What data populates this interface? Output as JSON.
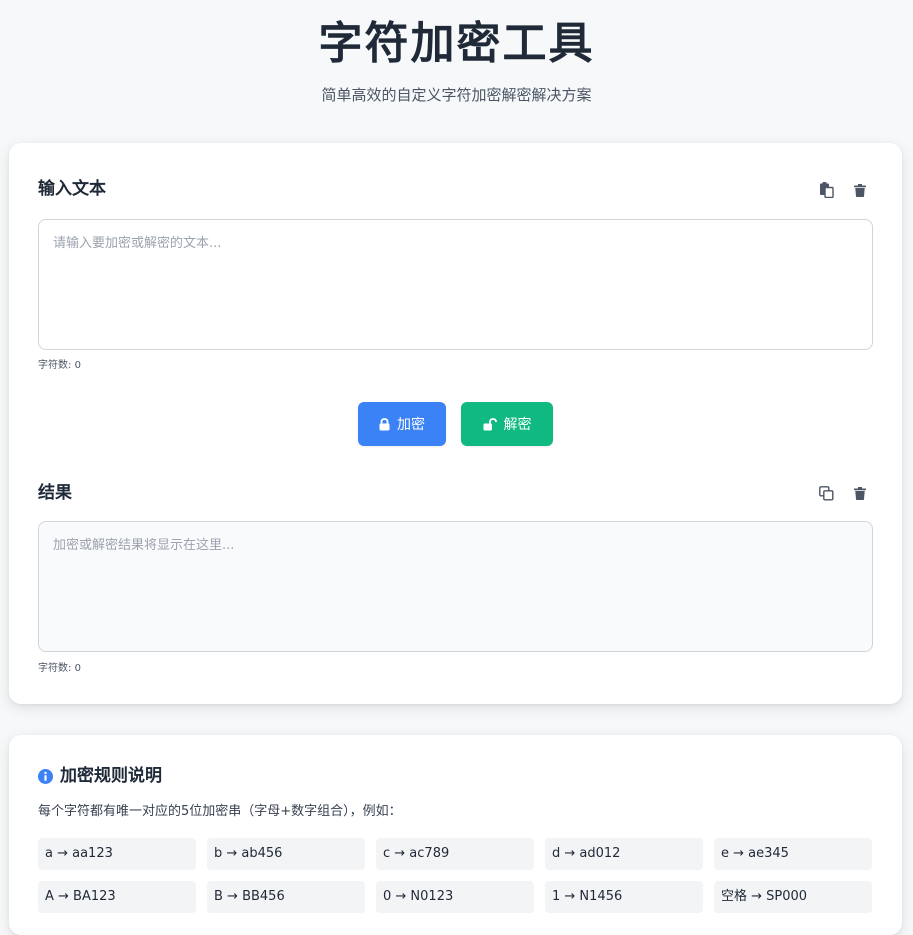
{
  "header": {
    "title": "字符加密工具",
    "subtitle": "简单高效的自定义字符加密解密解决方案"
  },
  "input_section": {
    "title": "输入文本",
    "placeholder": "请输入要加密或解密的文本...",
    "value": "",
    "char_count_label": "字符数: ",
    "char_count": "0"
  },
  "actions": {
    "encrypt_label": "加密",
    "decrypt_label": "解密"
  },
  "result_section": {
    "title": "结果",
    "placeholder": "加密或解密结果将显示在这里...",
    "value": "",
    "char_count_label": "字符数: ",
    "char_count": "0"
  },
  "rules": {
    "title": "加密规则说明",
    "description": "每个字符都有唯一对应的5位加密串（字母+数字组合），例如：",
    "examples": [
      "a → aa123",
      "b → ab456",
      "c → ac789",
      "d → ad012",
      "e → ae345",
      "A → BA123",
      "B → BB456",
      "0 → N0123",
      "1 → N1456",
      "空格 → SP000"
    ]
  },
  "icons": {
    "paste": "paste-icon",
    "trash": "trash-icon",
    "copy": "copy-icon",
    "lock": "lock-icon",
    "unlock": "unlock-icon",
    "info": "info-icon"
  },
  "colors": {
    "encrypt_button": "#3b82f6",
    "decrypt_button": "#10b981",
    "info_icon": "#3b82f6",
    "background": "#f6f8fa"
  }
}
